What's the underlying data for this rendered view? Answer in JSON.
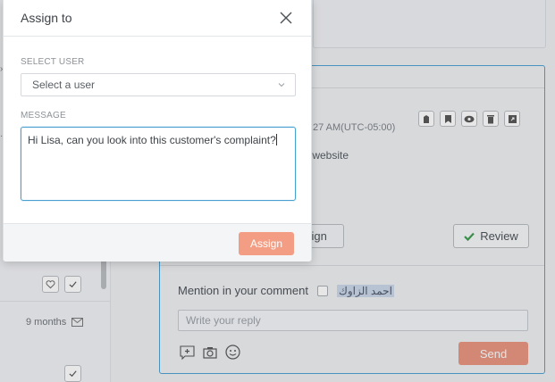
{
  "background": {
    "timestamp": "27 AM(UTC-05:00)",
    "snippet": "r website",
    "assign_partial": "sign",
    "review_label": "Review",
    "mention_label": "Mention in your comment",
    "mention_name": "احمد الزاوك",
    "reply_placeholder": "Write your reply",
    "send_label": "Send",
    "months_label": "9 months",
    "action_icons": [
      "tag-icon",
      "bookmark-icon",
      "eye-icon",
      "trash-icon",
      "export-icon"
    ],
    "colors": {
      "accent_blue": "#4a9fd1",
      "send": "#e88a70",
      "review_check": "#3a9a4a"
    }
  },
  "modal": {
    "title": "Assign to",
    "select_user_label": "SELECT USER",
    "select_user_placeholder": "Select a user",
    "message_label": "MESSAGE",
    "message_value": "Hi Lisa, can you look into this customer's complaint?",
    "assign_label": "Assign",
    "colors": {
      "assign_button": "#f39e84",
      "focus_border": "#4a9fd1"
    }
  }
}
